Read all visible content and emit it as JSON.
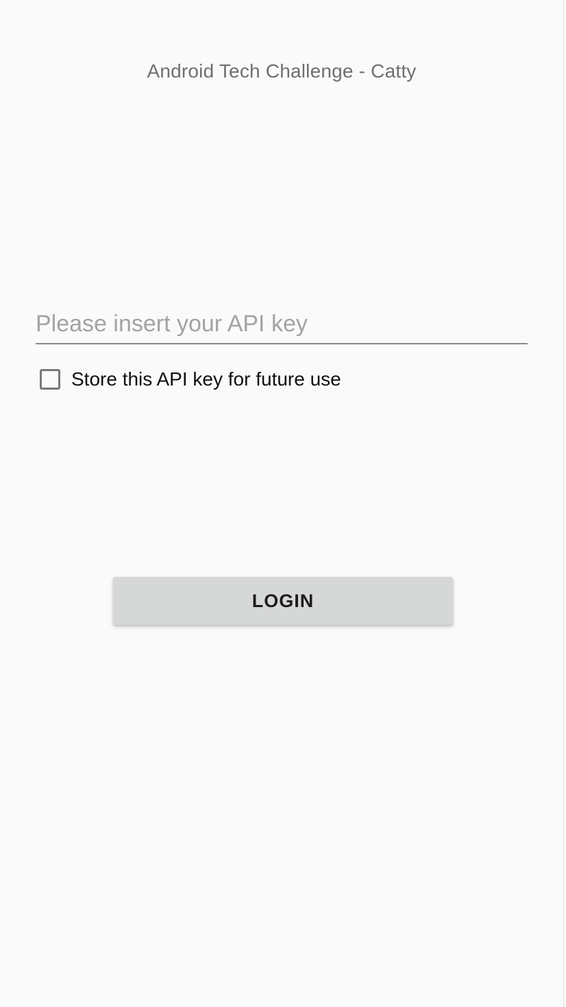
{
  "app": {
    "title": "Android Tech Challenge - Catty"
  },
  "login_form": {
    "api_key_input": {
      "value": "",
      "placeholder": "Please insert your API key"
    },
    "store_checkbox": {
      "label": "Store this API key for future use",
      "checked": false
    },
    "login_button_label": "LOGIN"
  },
  "colors": {
    "background": "#fafafa",
    "title_text": "#6f6f6f",
    "placeholder_text": "#a3a3a3",
    "input_underline": "#8a8a8a",
    "button_background": "#d6d7d7",
    "button_text": "#1c1c1c"
  }
}
